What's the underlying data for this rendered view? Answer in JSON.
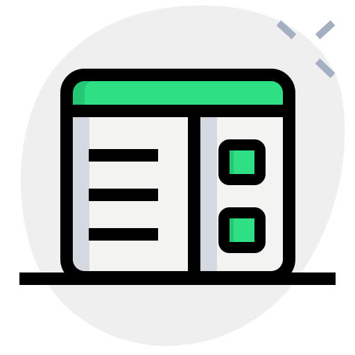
{
  "icon": {
    "name": "browser-window-sidebar-layout-icon",
    "style": "filled-outline",
    "sparkle_icon": "sparkle-icon",
    "colors": {
      "background_blob": "#efefef",
      "window_fill": "#f3f3f1",
      "shadow_fill": "#d5d8e1",
      "title_bar": "#2fdf84",
      "title_bar_shade": "#24c774",
      "outline": "#000000",
      "sparkle": "#a4afc1",
      "checkbox_fill": "#2fdf84",
      "checkbox_shade": "#24c774"
    },
    "list_lines": 3,
    "checkboxes": 2
  }
}
